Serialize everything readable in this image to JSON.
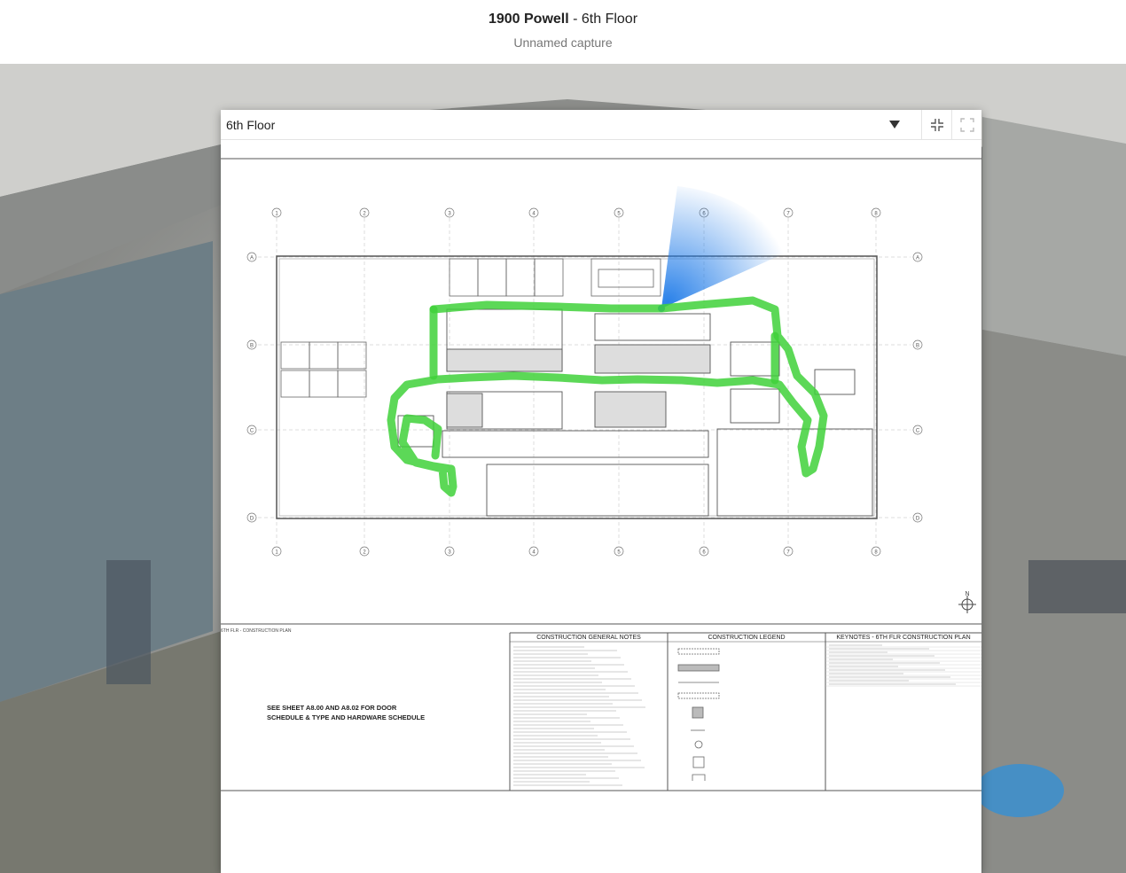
{
  "header": {
    "project": "1900 Powell",
    "separator": " - ",
    "floor": "6th Floor",
    "capture_name": "Unnamed capture"
  },
  "panel": {
    "selected_floor": "6th Floor",
    "dropdown_icon": "caret-down-icon",
    "shrink_icon": "shrink-icon",
    "expand_icon": "fullscreen-icon"
  },
  "sheet": {
    "plan_label": "6TH FLR - CONSTRUCTION PLAN",
    "general_notes_title": "CONSTRUCTION GENERAL NOTES",
    "legend_title": "CONSTRUCTION LEGEND",
    "keynotes_title": "KEYNOTES - 6TH FLR CONSTRUCTION PLAN",
    "door_note_line1": "SEE SHEET A8.00 AND A8.02 FOR DOOR",
    "door_note_line2": "SCHEDULE & TYPE AND HARDWARE SCHEDULE",
    "north_label": "N",
    "grid_columns": [
      "1",
      "2",
      "3",
      "4",
      "5",
      "6",
      "7",
      "8"
    ],
    "grid_rows": [
      "A",
      "B",
      "C",
      "D"
    ]
  },
  "colors": {
    "path": "#3fd13a",
    "view_cone": "#1f7be8",
    "line": "#555555"
  }
}
